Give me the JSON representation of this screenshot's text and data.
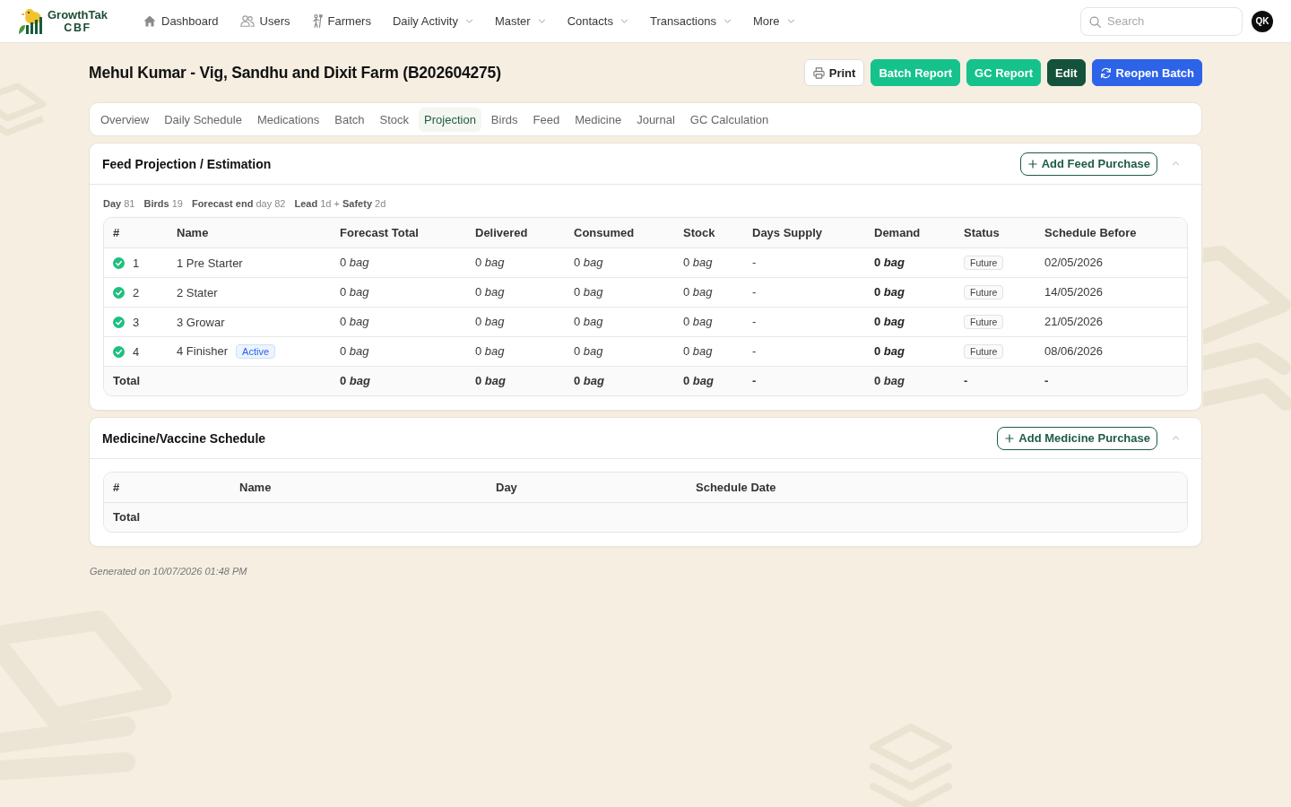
{
  "nav": {
    "brand": {
      "name": "GrowthTak",
      "sub": "CBF"
    },
    "items": [
      {
        "label": "Dashboard",
        "kind": "link"
      },
      {
        "label": "Users",
        "kind": "link"
      },
      {
        "label": "Farmers",
        "kind": "link"
      },
      {
        "label": "Daily Activity",
        "kind": "menu"
      },
      {
        "label": "Master",
        "kind": "menu"
      },
      {
        "label": "Contacts",
        "kind": "menu"
      },
      {
        "label": "Transactions",
        "kind": "menu"
      },
      {
        "label": "More",
        "kind": "menu"
      }
    ],
    "search": {
      "placeholder": "Search"
    },
    "avatar": "QK"
  },
  "page": {
    "title": "Mehul Kumar - Vig, Sandhu and Dixit Farm (B202604275)",
    "actions": [
      {
        "label": "Print",
        "kind": "outline"
      },
      {
        "label": "Batch Report",
        "kind": "success"
      },
      {
        "label": "GC Report",
        "kind": "success"
      },
      {
        "label": "Edit",
        "kind": "dark"
      },
      {
        "label": "Reopen Batch",
        "kind": "primary"
      }
    ]
  },
  "tabs": [
    {
      "label": "Overview",
      "selected": false
    },
    {
      "label": "Daily Schedule",
      "selected": false
    },
    {
      "label": "Medications",
      "selected": false
    },
    {
      "label": "Batch",
      "selected": false
    },
    {
      "label": "Stock",
      "selected": false
    },
    {
      "label": "Projection",
      "selected": true
    },
    {
      "label": "Birds",
      "selected": false
    },
    {
      "label": "Feed",
      "selected": false
    },
    {
      "label": "Medicine",
      "selected": false
    },
    {
      "label": "Journal",
      "selected": false
    },
    {
      "label": "GC Calculation",
      "selected": false
    }
  ],
  "feed": {
    "title": "Feed Projection / Estimation",
    "action": "Add Feed Purchase",
    "expanded": true,
    "summary": [
      "**Day** 81",
      "**Birds** 19",
      "**Forecast end** day 82",
      "**Lead** 1d + **Safety** 2d"
    ],
    "table": {
      "columns": [
        "#",
        "Name",
        "Forecast Total",
        "Delivered",
        "Consumed",
        "Stock",
        "Days Supply",
        "Demand",
        "Status",
        "Schedule Before"
      ],
      "rows": [
        {
          "complete": true,
          "cells": [
            "1",
            "1 Pre Starter",
            "0 *bag*",
            "0 *bag*",
            "0 *bag*",
            "0 *bag*",
            "-",
            "0 *bag*",
            "Future",
            "02/05/2026"
          ]
        },
        {
          "complete": true,
          "cells": [
            "2",
            "2 Stater",
            "0 *bag*",
            "0 *bag*",
            "0 *bag*",
            "0 *bag*",
            "-",
            "0 *bag*",
            "Future",
            "14/05/2026"
          ]
        },
        {
          "complete": true,
          "cells": [
            "3",
            "3 Growar",
            "0 *bag*",
            "0 *bag*",
            "0 *bag*",
            "0 *bag*",
            "-",
            "0 *bag*",
            "Future",
            "21/05/2026"
          ]
        },
        {
          "complete": true,
          "tag": "Active",
          "cells": [
            "4",
            "4 Finisher",
            "0 *bag*",
            "0 *bag*",
            "0 *bag*",
            "0 *bag*",
            "-",
            "0 *bag*",
            "Future",
            "08/06/2026"
          ]
        }
      ],
      "total": {
        "cells": [
          "Total",
          "",
          "0 *bag*",
          "0 *bag*",
          "0 *bag*",
          "0 *bag*",
          "-",
          "0 *bag*",
          "-",
          "-"
        ]
      }
    }
  },
  "medicine": {
    "title": "Medicine/Vaccine Schedule",
    "action": "Add Medicine Purchase",
    "expanded": true,
    "table": {
      "columns": [
        "#",
        "Name",
        "Day",
        "Schedule Date"
      ],
      "total": {
        "cells": [
          "Total"
        ]
      }
    }
  },
  "footer": "Generated on 10/07/2026 01:48 PM"
}
